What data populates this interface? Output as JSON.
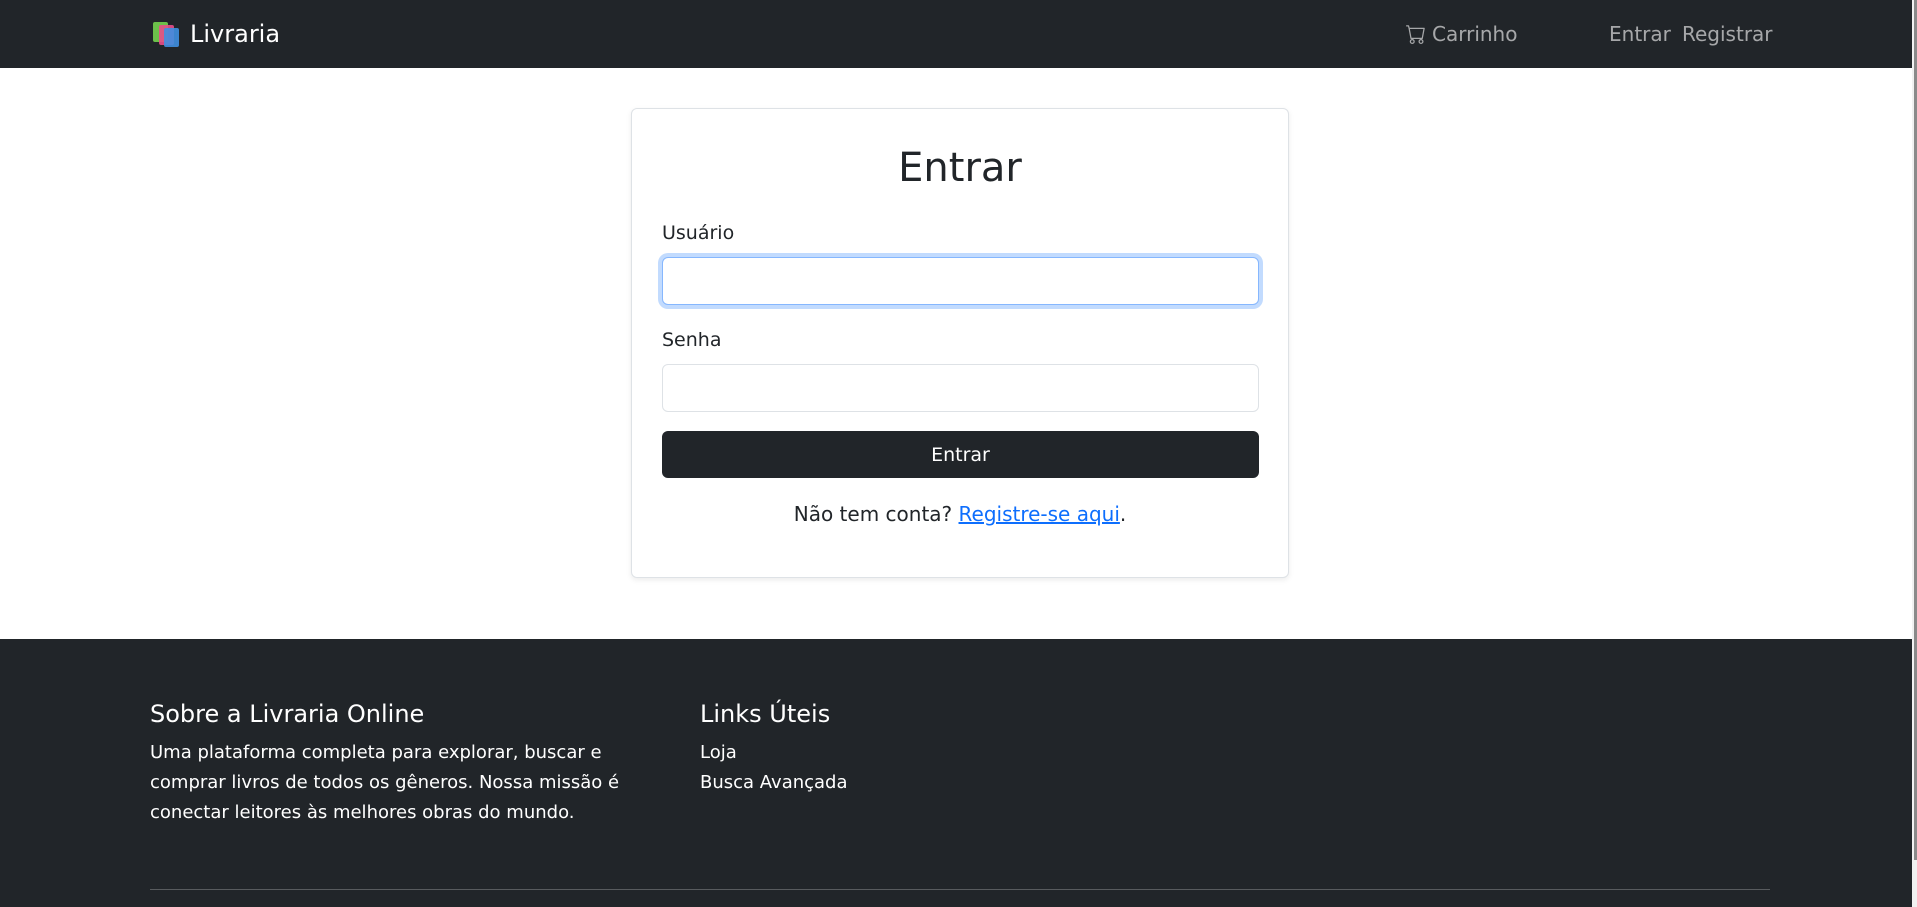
{
  "navbar": {
    "brand": "Livraria",
    "brand_icon": "books-icon",
    "cart_label": "Carrinho",
    "cart_icon": "cart-icon",
    "login_label": "Entrar",
    "register_label": "Registrar"
  },
  "login": {
    "title": "Entrar",
    "username_label": "Usuário",
    "username_value": "",
    "password_label": "Senha",
    "password_value": "",
    "submit_label": "Entrar",
    "no_account_text": "Não tem conta?",
    "register_link": "Registre-se aqui",
    "register_suffix": "."
  },
  "footer": {
    "about_title": "Sobre a Livraria Online",
    "about_text": "Uma plataforma completa para explorar, buscar e comprar livros de todos os gêneros. Nossa missão é conectar leitores às melhores obras do mundo.",
    "links_title": "Links Úteis",
    "links": [
      "Loja",
      "Busca Avançada"
    ]
  },
  "colors": {
    "navbar_bg": "#212529",
    "link_blue": "#0d6efd",
    "focus_ring": "#86b7fe"
  }
}
